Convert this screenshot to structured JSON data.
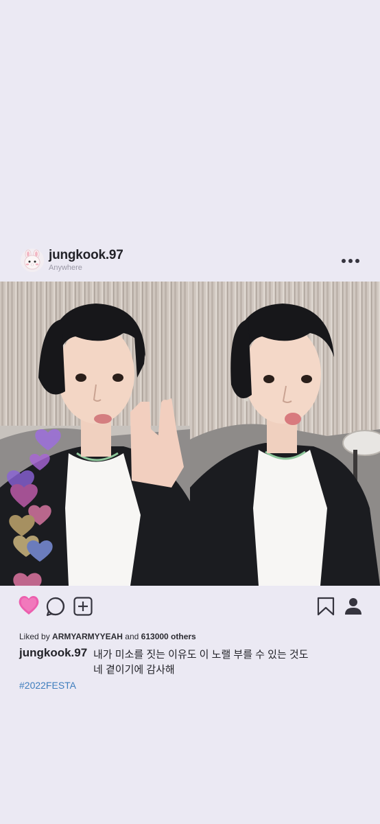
{
  "post": {
    "username": "jungkook.97",
    "location": "Anywhere",
    "more_icon": "more-horizontal-icon",
    "likes": {
      "prefix": "Liked by",
      "user": "ARMYARMYYEAH",
      "conjunction": "and",
      "count": "613000 others"
    },
    "caption": {
      "username": "jungkook.97",
      "line1": "내가 미소를 짓는 이유도 이 노랠 부를 수 있는 것도",
      "line2": "네 곁이기에 감사해"
    },
    "hashtag": "#2022FESTA"
  },
  "actions": {
    "like_icon": "heart-icon",
    "comment_icon": "comment-icon",
    "add_icon": "plus-square-icon",
    "save_icon": "bookmark-icon",
    "profile_icon": "user-icon"
  },
  "colors": {
    "background": "#ebe9f3",
    "text": "#222228",
    "muted": "#9a98a6",
    "hashtag": "#3e7dbd",
    "heart": "#e94fa8"
  }
}
